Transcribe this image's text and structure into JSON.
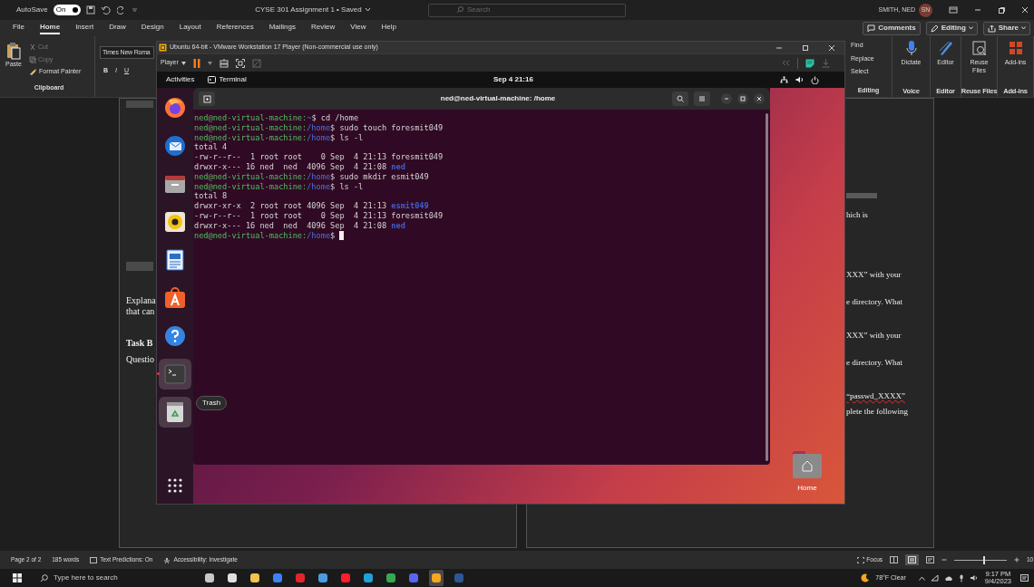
{
  "word": {
    "title_bar": {
      "autosave_label": "AutoSave",
      "autosave_state": "On",
      "autosave_on": true,
      "document_title": "CYSE 301 Assignment 1 • Saved",
      "search_placeholder": "Search",
      "user_name": "SMITH, NED",
      "user_initials": "SN"
    },
    "ribbon_tabs": [
      {
        "label": "File",
        "selected": false
      },
      {
        "label": "Home",
        "selected": true
      },
      {
        "label": "Insert",
        "selected": false
      },
      {
        "label": "Draw",
        "selected": false
      },
      {
        "label": "Design",
        "selected": false
      },
      {
        "label": "Layout",
        "selected": false
      },
      {
        "label": "References",
        "selected": false
      },
      {
        "label": "Mailings",
        "selected": false
      },
      {
        "label": "Review",
        "selected": false
      },
      {
        "label": "View",
        "selected": false
      },
      {
        "label": "Help",
        "selected": false
      }
    ],
    "ribbon_buttons": [
      "Comments",
      "Editing",
      "Share"
    ],
    "clipboard": {
      "paste": "Paste",
      "cut": "Cut",
      "copy": "Copy",
      "format_painter": "Format Painter",
      "group_label": "Clipboard"
    },
    "font": {
      "font_name": "Times New Roma",
      "format_buttons": [
        "B",
        "I",
        "U"
      ]
    },
    "editing": {
      "items": [
        "Find",
        "Replace",
        "Select"
      ],
      "group_label": "Editing"
    },
    "tool_groups": [
      {
        "kind": "dictate",
        "button": "Dictate",
        "group_label": "Voice"
      },
      {
        "kind": "editor",
        "button": "Editor",
        "group_label": "Editor"
      },
      {
        "kind": "reuse",
        "button": "Reuse Files",
        "group_label": "Reuse Files"
      },
      {
        "kind": "addins",
        "button": "Add-ins",
        "group_label": "Add-ins"
      }
    ],
    "left_page_lines": [
      {
        "text": "Explana",
        "bold": false
      },
      {
        "text": "that can",
        "bold": false
      },
      {
        "text": "Task B",
        "bold": true
      },
      {
        "text": "Questio",
        "bold": false
      }
    ],
    "right_page_lines": [
      {
        "text": "hich is",
        "spelling_error": false
      },
      {
        "text": "XXX” with your",
        "spelling_error": false
      },
      {
        "text": "e directory. What",
        "spelling_error": false
      },
      {
        "text": "XXX” with your",
        "spelling_error": false
      },
      {
        "text": "e directory. What",
        "spelling_error": false
      },
      {
        "text": "“passwd_XXXX”",
        "spelling_error": true
      },
      {
        "text": "plete the following",
        "spelling_error": false
      }
    ],
    "status_bar": {
      "items": [
        "Page 2 of 2",
        "185 words",
        "Text Predictions: On",
        "Accessibility: Investigate"
      ],
      "focus": "Focus",
      "zoom_slider": {
        "level": 0.55
      },
      "zoom": "10"
    }
  },
  "vmware": {
    "title": "Ubuntu 64-bit - VMware Workstation 17 Player (Non-commercial use only)",
    "player_menu": "Player"
  },
  "ubuntu": {
    "activities": "Activities",
    "app_menu": "Terminal",
    "clock": "Sep 4 21:16",
    "dock": [
      {
        "kind": "browser",
        "highlighted": false,
        "running": false
      },
      {
        "kind": "mail",
        "highlighted": false,
        "running": false
      },
      {
        "kind": "folder",
        "highlighted": false,
        "running": false
      },
      {
        "kind": "speaker",
        "highlighted": false,
        "running": false
      },
      {
        "kind": "document",
        "highlighted": false,
        "running": false
      },
      {
        "kind": "store",
        "highlighted": false,
        "running": false
      },
      {
        "kind": "help",
        "highlighted": false,
        "running": false
      },
      {
        "kind": "terminal",
        "highlighted": true,
        "running": true
      },
      {
        "kind": "trash",
        "highlighted": true,
        "running": false
      }
    ],
    "trash_tooltip": "Trash",
    "desktop_icons": [
      {
        "label": "Home"
      }
    ],
    "terminal": {
      "title": "ned@ned-virtual-machine: /home",
      "lines": [
        [
          {
            "kind": "prompt",
            "text": "ned@ned-virtual-machine:"
          },
          {
            "kind": "path",
            "text": "~"
          },
          {
            "kind": "plain",
            "text": "$ cd /home"
          }
        ],
        [
          {
            "kind": "prompt",
            "text": "ned@ned-virtual-machine:"
          },
          {
            "kind": "path",
            "text": "/home"
          },
          {
            "kind": "plain",
            "text": "$ sudo touch foresmit049"
          }
        ],
        [
          {
            "kind": "prompt",
            "text": "ned@ned-virtual-machine:"
          },
          {
            "kind": "path",
            "text": "/home"
          },
          {
            "kind": "plain",
            "text": "$ ls -l"
          }
        ],
        [
          {
            "kind": "plain",
            "text": "total 4"
          }
        ],
        [
          {
            "kind": "plain",
            "text": "-rw-r--r--  1 root root    0 Sep  4 21:13 foresmit049"
          }
        ],
        [
          {
            "kind": "plain",
            "text": "drwxr-x--- 16 ned  ned  4096 Sep  4 21:08 "
          },
          {
            "kind": "dir",
            "text": "ned"
          }
        ],
        [
          {
            "kind": "prompt",
            "text": "ned@ned-virtual-machine:"
          },
          {
            "kind": "path",
            "text": "/home"
          },
          {
            "kind": "plain",
            "text": "$ sudo mkdir esmit049"
          }
        ],
        [
          {
            "kind": "prompt",
            "text": "ned@ned-virtual-machine:"
          },
          {
            "kind": "path",
            "text": "/home"
          },
          {
            "kind": "plain",
            "text": "$ ls -l"
          }
        ],
        [
          {
            "kind": "plain",
            "text": "total 8"
          }
        ],
        [
          {
            "kind": "plain",
            "text": "drwxr-xr-x  2 root root 4096 Sep  4 21:13 "
          },
          {
            "kind": "dir",
            "text": "esmit049"
          }
        ],
        [
          {
            "kind": "plain",
            "text": "-rw-r--r--  1 root root    0 Sep  4 21:13 foresmit049"
          }
        ],
        [
          {
            "kind": "plain",
            "text": "drwxr-x--- 16 ned  ned  4096 Sep  4 21:08 "
          },
          {
            "kind": "dir",
            "text": "ned"
          }
        ],
        [
          {
            "kind": "prompt",
            "text": "ned@ned-virtual-machine:"
          },
          {
            "kind": "path",
            "text": "/home"
          },
          {
            "kind": "plain",
            "text": "$ "
          }
        ]
      ],
      "cursor": true
    }
  },
  "taskbar": {
    "search_placeholder": "Type here to search",
    "apps": [
      {
        "color": "#c8c8c8",
        "active": false
      },
      {
        "color": "#e0e0e0",
        "active": false
      },
      {
        "color": "#f2c14e",
        "active": false
      },
      {
        "color": "#3b82f6",
        "active": false
      },
      {
        "color": "#e0262b",
        "active": false
      },
      {
        "color": "#4b9be0",
        "active": false
      },
      {
        "color": "#ff1b2d",
        "active": false
      },
      {
        "color": "#1fa2d8",
        "active": false
      },
      {
        "color": "#34a853",
        "active": false
      },
      {
        "color": "#5865f2",
        "active": false
      },
      {
        "color": "#f5a623",
        "active": true
      },
      {
        "color": "#2b5797",
        "active": false
      }
    ],
    "weather": "78°F Clear",
    "time": "9:17 PM",
    "date": "9/4/2023"
  }
}
